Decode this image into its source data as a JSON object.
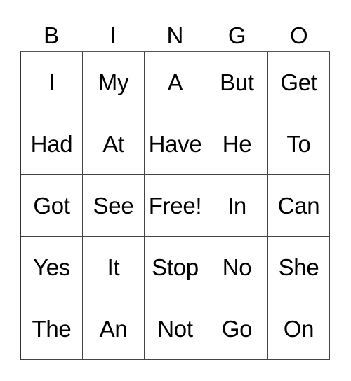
{
  "header": [
    "B",
    "I",
    "N",
    "G",
    "O"
  ],
  "cells": [
    [
      "I",
      "My",
      "A",
      "But",
      "Get"
    ],
    [
      "Had",
      "At",
      "Have",
      "He",
      "To"
    ],
    [
      "Got",
      "See",
      "Free!",
      "In",
      "Can"
    ],
    [
      "Yes",
      "It",
      "Stop",
      "No",
      "She"
    ],
    [
      "The",
      "An",
      "Not",
      "Go",
      "On"
    ]
  ]
}
